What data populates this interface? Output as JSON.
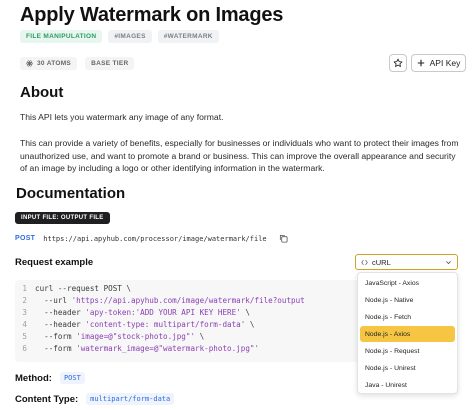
{
  "page": {
    "title": "Apply Watermark on Images"
  },
  "tags": [
    "FILE MANIPULATION",
    "#IMAGES",
    "#WATERMARK"
  ],
  "meta": {
    "atoms": "30 ATOMS",
    "tier": "BASE TIER"
  },
  "actions": {
    "api_key_label": "API Key"
  },
  "about": {
    "heading": "About",
    "p1": "This API lets you watermark any image of any format.",
    "p2": "This can provide a variety of benefits, especially for businesses or individuals who want to protect their images from unauthorized use, and want to promote a brand or business. This can improve the overall appearance and security of an image by including a logo or other identifying information in the watermark."
  },
  "docs": {
    "heading": "Documentation",
    "io_badge": "INPUT FILE: OUTPUT FILE",
    "method": "POST",
    "url": "https://api.apyhub.com/processor/image/watermark/file",
    "request_heading": "Request example"
  },
  "code": {
    "lines": [
      {
        "n": "1",
        "cmd": "curl --request POST \\",
        "str": ""
      },
      {
        "n": "2",
        "cmd": "  --url ",
        "str": "'https://api.apyhub.com/image/watermark/file?output"
      },
      {
        "n": "3",
        "cmd": "  --header ",
        "str": "'apy-token:'ADD YOUR API KEY HERE'",
        "tail": " \\"
      },
      {
        "n": "4",
        "cmd": "  --header ",
        "str": "'content-type: multipart/form-data'",
        "tail": " \\"
      },
      {
        "n": "5",
        "cmd": "  --form ",
        "str": "'image=@\"stock-photo.jpg\"'",
        "tail": " \\"
      },
      {
        "n": "6",
        "cmd": "  --form ",
        "str": "'watermark_image=@\"watermark-photo.jpg\"'"
      }
    ]
  },
  "language_select": {
    "selected": "cURL",
    "options": [
      "JavaScript - Axios",
      "Node.js - Native",
      "Node.js - Fetch",
      "Node.js - Axios",
      "Node.js - Request",
      "Node.js - Unirest",
      "Java - Unirest"
    ],
    "highlighted": "Node.js - Axios"
  },
  "details": {
    "method_label": "Method:",
    "method_value": "POST",
    "content_type_label": "Content Type:",
    "content_type_value": "multipart/form-data"
  },
  "colors": {
    "accent": "#f6c544",
    "link": "#2d6cdf",
    "tag_green": "#2e9a63"
  }
}
